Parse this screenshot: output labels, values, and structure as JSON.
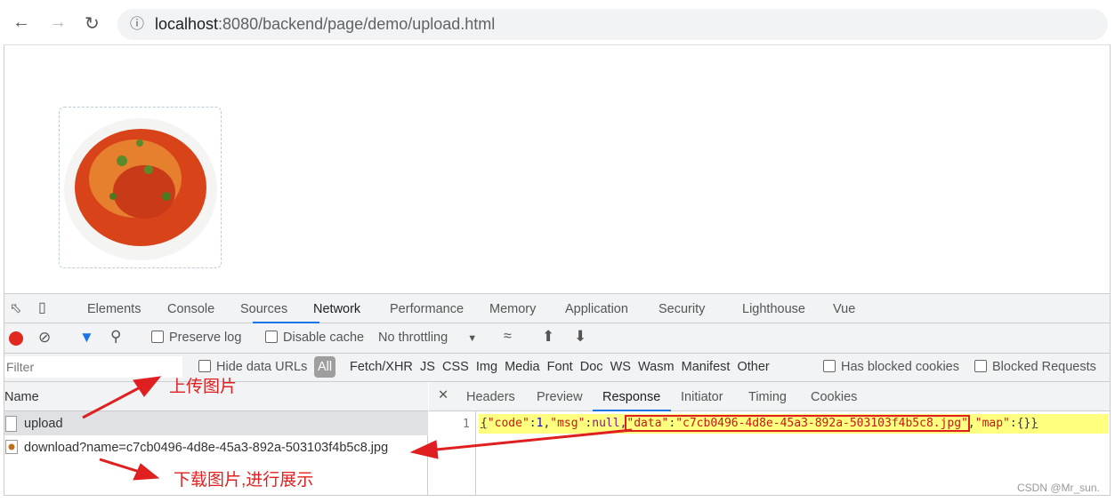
{
  "browser": {
    "url_host": "localhost",
    "url_rest": ":8080/backend/page/demo/upload.html"
  },
  "page": {
    "image": "uploaded food image (mapo tofu)"
  },
  "devtools": {
    "tabs": [
      "Elements",
      "Console",
      "Sources",
      "Network",
      "Performance",
      "Memory",
      "Application",
      "Security",
      "Lighthouse",
      "Vue"
    ],
    "active_tab": "Network",
    "toolbar": {
      "preserve_log": "Preserve log",
      "disable_cache": "Disable cache",
      "throttling": "No throttling"
    },
    "filter": {
      "placeholder": "Filter",
      "hide_data_urls": "Hide data URLs",
      "types": [
        "All",
        "Fetch/XHR",
        "JS",
        "CSS",
        "Img",
        "Media",
        "Font",
        "Doc",
        "WS",
        "Wasm",
        "Manifest",
        "Other"
      ],
      "blocked_cookies": "Has blocked cookies",
      "blocked_requests": "Blocked Requests"
    },
    "requests_header": "Name",
    "requests": [
      "upload",
      "download?name=c7cb0496-4d8e-45a3-892a-503103f4b5c8.jpg"
    ],
    "detail_tabs": [
      "Headers",
      "Preview",
      "Response",
      "Initiator",
      "Timing",
      "Cookies"
    ],
    "response": {
      "line_no": "1",
      "p1": "{",
      "k_code": "\"code\"",
      "c1": ":",
      "v_code": "1",
      "c2": ",",
      "k_msg": "\"msg\"",
      "c3": ":",
      "v_msg": "null",
      "c4": ",",
      "k_data": "\"data\"",
      "c5": ":",
      "v_data": "\"c7cb0496-4d8e-45a3-892a-503103f4b5c8.jpg\"",
      "c6": ",",
      "k_map": "\"map\"",
      "c7": ":",
      "v_map": "{}",
      "p2": "}"
    }
  },
  "annotations": {
    "upload": "上传图片",
    "download": "下载图片,进行展示"
  },
  "watermark": "CSDN @Mr_sun."
}
